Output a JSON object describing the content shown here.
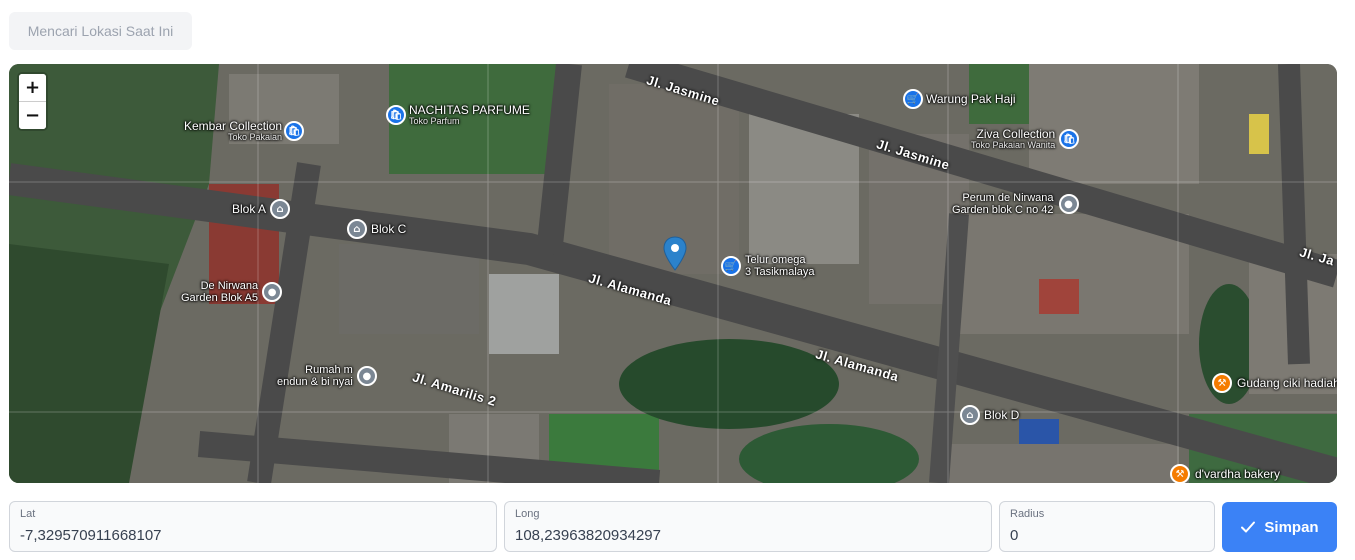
{
  "locate_button": {
    "label": "Mencari Lokasi Saat Ini"
  },
  "map": {
    "zoom_in_label": "+",
    "zoom_out_label": "−",
    "pois": [
      {
        "name": "Kembar Collection",
        "sub": "Toko Pakaian",
        "icon": "shopping-bag-icon",
        "color": "#1a73e8"
      },
      {
        "name": "NACHITAS PARFUME",
        "sub": "Toko Parfum",
        "icon": "shopping-bag-icon",
        "color": "#1a73e8"
      },
      {
        "name": "Warung Pak Haji",
        "sub": "",
        "icon": "cart-icon",
        "color": "#1a73e8"
      },
      {
        "name": "Ziva Collection",
        "sub": "Toko Pakaian Wanita",
        "icon": "shopping-bag-icon",
        "color": "#1a73e8"
      },
      {
        "name": "Blok A",
        "sub": "",
        "icon": "building-icon",
        "color": "#7b8794"
      },
      {
        "name": "Blok C",
        "sub": "",
        "icon": "building-icon",
        "color": "#7b8794"
      },
      {
        "name": "Perum de Nirwana",
        "sub": "Garden blok C no 42",
        "icon": "place-icon",
        "color": "#7b8794"
      },
      {
        "name": "De Nirwana",
        "sub": "Garden Blok A5",
        "icon": "place-icon",
        "color": "#7b8794"
      },
      {
        "name": "Telur omega",
        "sub": "3 Tasikmalaya",
        "icon": "cart-icon",
        "color": "#1a73e8"
      },
      {
        "name": "Rumah m",
        "sub": "endun & bi nyai",
        "icon": "place-icon",
        "color": "#7b8794"
      },
      {
        "name": "Gudang ciki hadiah",
        "sub": "",
        "icon": "restaurant-icon",
        "color": "#f57c00"
      },
      {
        "name": "Blok D",
        "sub": "",
        "icon": "building-icon",
        "color": "#7b8794"
      },
      {
        "name": "d'vardha bakery",
        "sub": "",
        "icon": "restaurant-icon",
        "color": "#f57c00"
      }
    ],
    "roads": [
      "Jl. Jasmine",
      "Jl. Jasmine",
      "Jl. Ja",
      "Jl. Alamanda",
      "Jl. Alamanda",
      "Jl. Amarilis 2"
    ],
    "marker_color": "#2b82cb"
  },
  "form": {
    "lat": {
      "label": "Lat",
      "value": "-7,329570911668107"
    },
    "long": {
      "label": "Long",
      "value": "108,23963820934297"
    },
    "radius": {
      "label": "Radius",
      "value": "0"
    },
    "save_label": "Simpan"
  },
  "colors": {
    "accent": "#3b82f6"
  }
}
